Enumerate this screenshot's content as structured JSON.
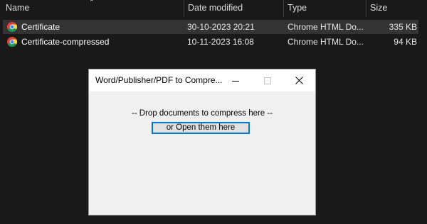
{
  "explorer": {
    "columns": {
      "name": "Name",
      "date_modified": "Date modified",
      "type": "Type",
      "size": "Size"
    },
    "files": [
      {
        "name": "Certificate",
        "date": "30-10-2023 20:21",
        "type": "Chrome HTML Do...",
        "size": "335 KB",
        "icon": "chrome-icon",
        "selected": true
      },
      {
        "name": "Certificate-compressed",
        "date": "10-11-2023 16:08",
        "type": "Chrome HTML Do...",
        "size": "94 KB",
        "icon": "chrome-icon",
        "selected": false
      }
    ]
  },
  "dialog": {
    "title": "Word/Publisher/PDF to Compre...",
    "drop_label": "-- Drop documents to compress here --",
    "open_button": "or Open them here",
    "controls": [
      "minimize-icon",
      "maximize-icon",
      "close-icon"
    ]
  },
  "colors": {
    "background": "#191919",
    "selected_row": "#333333",
    "dialog_bg": "#f0f0f0",
    "button_focus": "#0078d7"
  }
}
